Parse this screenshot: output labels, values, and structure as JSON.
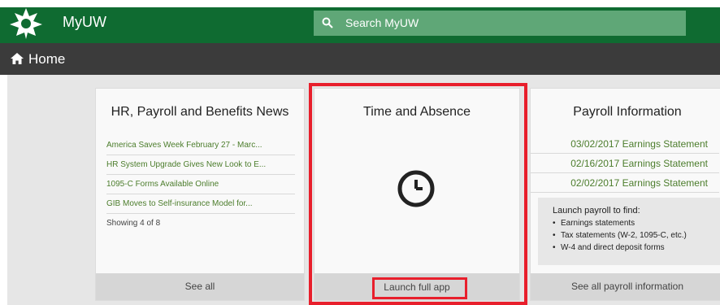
{
  "header": {
    "app_title": "MyUW",
    "search_placeholder": "Search MyUW"
  },
  "subbar": {
    "title": "Home"
  },
  "cards": {
    "hr": {
      "title": "HR, Payroll and Benefits News",
      "items": [
        "America Saves Week February 27 - Marc...",
        "HR System Upgrade Gives New Look to E...",
        "1095-C Forms Available Online",
        "GIB Moves to Self-insurance Model for..."
      ],
      "showing": "Showing 4 of 8",
      "footer": "See all"
    },
    "time": {
      "title": "Time and Absence",
      "footer": "Launch full app"
    },
    "payroll": {
      "title": "Payroll Information",
      "links": [
        "03/02/2017 Earnings Statement",
        "02/16/2017 Earnings Statement",
        "02/02/2017 Earnings Statement"
      ],
      "info_heading": "Launch payroll to find:",
      "info_items": [
        "Earnings statements",
        "Tax statements (W-2, 1095-C, etc.)",
        "W-4 and direct deposit forms"
      ],
      "footer": "See all payroll information"
    }
  },
  "colors": {
    "brand_green": "#0f6b31",
    "highlight_red": "#e81f2c",
    "link_green": "#4c7d2c"
  }
}
